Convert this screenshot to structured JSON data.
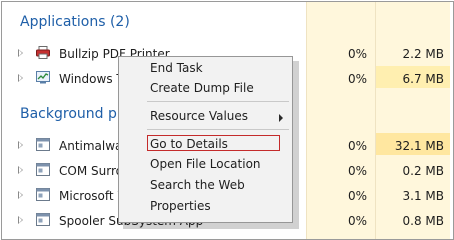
{
  "groups": {
    "applications": "Applications (2)",
    "background": "Background pro"
  },
  "rows": [
    {
      "name": "Bullzip PDF Printer",
      "cpu": "0%",
      "memory": "2.2 MB",
      "icon": "printer-icon"
    },
    {
      "name": "Windows Ta",
      "cpu": "0%",
      "memory": "6.7 MB",
      "icon": "task-manager-icon"
    },
    {
      "name": "Antimalware",
      "cpu": "0%",
      "memory": "32.1 MB",
      "icon": "process-icon"
    },
    {
      "name": "COM Surrog",
      "cpu": "0%",
      "memory": "0.2 MB",
      "icon": "process-icon"
    },
    {
      "name": "Microsoft W",
      "cpu": "0%",
      "memory": "3.1 MB",
      "icon": "process-icon"
    },
    {
      "name": "Spooler SubSystem App",
      "cpu": "0%",
      "memory": "0.8 MB",
      "icon": "process-icon"
    }
  ],
  "context_menu": {
    "end_task": "End Task",
    "create_dump_file": "Create Dump File",
    "resource_values": "Resource Values",
    "go_to_details": "Go to Details",
    "open_file_location": "Open File Location",
    "search_the_web": "Search the Web",
    "properties": "Properties"
  },
  "colors": {
    "group_header": "#1f5fa8",
    "column_tint": "#fff7dc",
    "highlight_border": "#c42b2b"
  }
}
